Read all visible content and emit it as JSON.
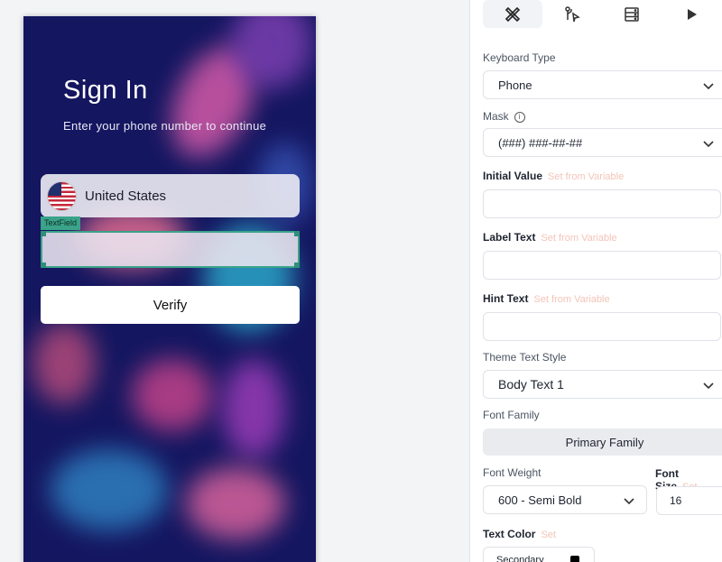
{
  "phone": {
    "title": "Sign In",
    "subtitle": "Enter your phone number to continue",
    "country_label": "United States",
    "widget_tag": "TextField",
    "phone_value": "",
    "verify_label": "Verify"
  },
  "panel": {
    "tabs": [
      "tools-icon",
      "flow-icon",
      "database-icon",
      "play-icon"
    ],
    "keyboard_type": {
      "label": "Keyboard Type",
      "value": "Phone"
    },
    "mask": {
      "label": "Mask",
      "value": "(###) ###-##-##"
    },
    "initial_value": {
      "label": "Initial Value",
      "hint": "Set from Variable",
      "value": ""
    },
    "label_text": {
      "label": "Label Text",
      "hint": "Set from Variable",
      "value": ""
    },
    "hint_text": {
      "label": "Hint Text",
      "hint": "Set from Variable",
      "value": ""
    },
    "theme_text_style": {
      "label": "Theme Text Style",
      "value": "Body Text 1"
    },
    "font_family": {
      "label": "Font Family",
      "value": "Primary Family"
    },
    "font_weight": {
      "label": "Font Weight",
      "value": "600 - Semi Bold"
    },
    "font_size": {
      "label": "Font Size",
      "hint": "Set",
      "value": "16"
    },
    "text_color": {
      "label": "Text Color",
      "hint": "Set",
      "value": "Secondary",
      "swatch": "#000000"
    }
  },
  "colors": {
    "accent": "#3aa38a",
    "phone_bg": "#141660",
    "hint": "#f3c4b8"
  }
}
